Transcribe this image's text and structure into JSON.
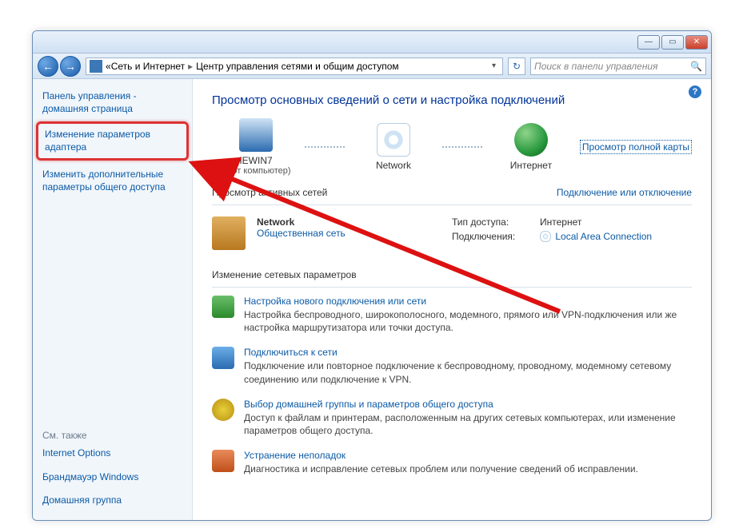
{
  "titlebar": {
    "min": "—",
    "max": "▭",
    "close": "✕"
  },
  "address": {
    "crumb_prefix": "«",
    "crumb1": "Сеть и Интернет",
    "crumb2": "Центр управления сетями и общим доступом",
    "search_placeholder": "Поиск в панели управления"
  },
  "sidebar": {
    "home": "Панель управления - домашняя страница",
    "adapters": "Изменение параметров адаптера",
    "advanced": "Изменить дополнительные параметры общего доступа",
    "see_also": "См. также",
    "internet_options": "Internet Options",
    "firewall": "Брандмауэр Windows",
    "homegroup": "Домашняя группа"
  },
  "main": {
    "heading": "Просмотр основных сведений о сети и настройка подключений",
    "map": {
      "pc_name": "IEWIN7",
      "pc_sub": "(этот компьютер)",
      "net_name": "Network",
      "inet_name": "Интернет",
      "full_map": "Просмотр полной карты"
    },
    "active": {
      "title": "Просмотр активных сетей",
      "toggle": "Подключение или отключение",
      "net_name": "Network",
      "net_type": "Общественная сеть",
      "k_access": "Тип доступа:",
      "v_access": "Интернет",
      "k_conn": "Подключения:",
      "v_conn": "Local Area Connection"
    },
    "change": {
      "title": "Изменение сетевых параметров",
      "t1_link": "Настройка нового подключения или сети",
      "t1_desc": "Настройка беспроводного, широкополосного, модемного, прямого или VPN-подключения или же настройка маршрутизатора или точки доступа.",
      "t2_link": "Подключиться к сети",
      "t2_desc": "Подключение или повторное подключение к беспроводному, проводному, модемному сетевому соединению или подключение к VPN.",
      "t3_link": "Выбор домашней группы и параметров общего доступа",
      "t3_desc": "Доступ к файлам и принтерам, расположенным на других сетевых компьютерах, или изменение параметров общего доступа.",
      "t4_link": "Устранение неполадок",
      "t4_desc": "Диагностика и исправление сетевых проблем или получение сведений об исправлении."
    }
  }
}
